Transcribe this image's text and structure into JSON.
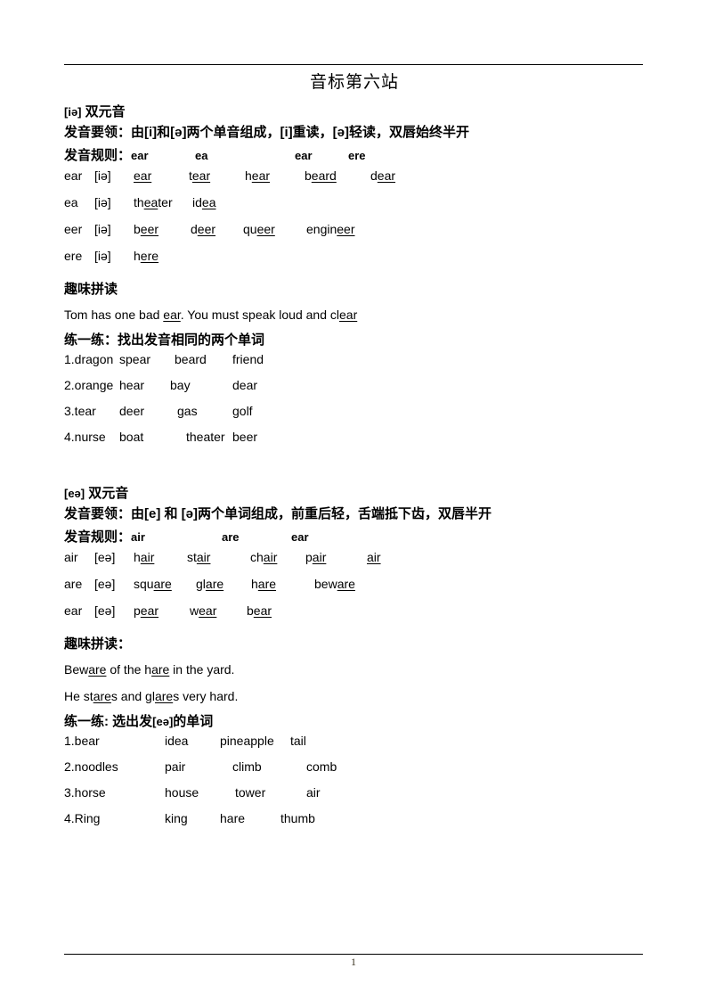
{
  "document": {
    "title": "音标第六站",
    "page_number": "1"
  },
  "sections": [
    {
      "id": "ia",
      "heading_ipa": "[iə]",
      "heading_text": " 双元音",
      "key_points_label": "发音要领：",
      "key_points_text": "由[i]和[ə]两个单音组成，[i]重读，[ə]轻读，双唇始终半开",
      "rules_label": "发音规则：",
      "rule_columns": [
        "ear",
        "ea",
        "ear",
        "ere"
      ],
      "word_rows": [
        {
          "key": "ear",
          "ipa": "[iə]",
          "words": [
            {
              "pre": "",
              "mid": "ear",
              "post": ""
            },
            {
              "pre": "t",
              "mid": "ear",
              "post": ""
            },
            {
              "pre": "h",
              "mid": "ear",
              "post": ""
            },
            {
              "pre": "b",
              "mid": "eard",
              "post": ""
            },
            {
              "pre": "d",
              "mid": "ear",
              "post": ""
            }
          ]
        },
        {
          "key": "ea",
          "ipa": "[iə]",
          "words": [
            {
              "pre": "th",
              "mid": "ea",
              "post": "ter"
            },
            {
              "pre": "id",
              "mid": "ea",
              "post": ""
            }
          ]
        },
        {
          "key": "eer",
          "ipa": "[iə]",
          "words": [
            {
              "pre": "b",
              "mid": "eer",
              "post": ""
            },
            {
              "pre": "d",
              "mid": "eer",
              "post": ""
            },
            {
              "pre": "qu",
              "mid": "eer",
              "post": ""
            },
            {
              "pre": "engin",
              "mid": "eer",
              "post": ""
            }
          ]
        },
        {
          "key": "ere",
          "ipa": "[iə]",
          "words": [
            {
              "pre": "h",
              "mid": "ere",
              "post": ""
            }
          ]
        }
      ],
      "fun_heading": "趣味拼读",
      "fun_lines": [
        [
          {
            "pre": "Tom has one bad ",
            "mid": "ear",
            "post": ". You must speak loud and cl"
          },
          {
            "pre": "",
            "mid": "ear",
            "post": ""
          }
        ]
      ],
      "practice_heading": "练一练：找出发音相同的两个单词",
      "practice_rows": [
        [
          "1.dragon",
          "spear",
          "beard",
          "friend"
        ],
        [
          "2.orange",
          "hear",
          "bay",
          "dear"
        ],
        [
          "3.tear",
          "deer",
          "gas",
          "golf"
        ],
        [
          "4.nurse",
          "boat",
          "theater",
          "beer"
        ]
      ]
    },
    {
      "id": "ea",
      "heading_ipa": "[eə]",
      "heading_text": " 双元音",
      "key_points_label": "发音要领：",
      "key_points_text": "由[e] 和 [ə]两个单词组成，前重后轻，舌端抵下齿，双唇半开",
      "rules_label": "发音规则：",
      "rule_columns": [
        "air",
        "are",
        "ear"
      ],
      "word_rows": [
        {
          "key": "air",
          "ipa": "[eə]",
          "words": [
            {
              "pre": "h",
              "mid": "air",
              "post": ""
            },
            {
              "pre": "st",
              "mid": "air",
              "post": ""
            },
            {
              "pre": "ch",
              "mid": "air",
              "post": ""
            },
            {
              "pre": "p",
              "mid": "air",
              "post": ""
            },
            {
              "pre": "",
              "mid": "air",
              "post": ""
            }
          ]
        },
        {
          "key": "are",
          "ipa": "[eə]",
          "words": [
            {
              "pre": "squ",
              "mid": "are",
              "post": ""
            },
            {
              "pre": "gl",
              "mid": "are",
              "post": ""
            },
            {
              "pre": "h",
              "mid": "are",
              "post": ""
            },
            {
              "pre": "bew",
              "mid": "are",
              "post": ""
            }
          ]
        },
        {
          "key": "ear",
          "ipa": "[eə]",
          "words": [
            {
              "pre": "p",
              "mid": "ear",
              "post": ""
            },
            {
              "pre": "w",
              "mid": "ear",
              "post": ""
            },
            {
              "pre": "b",
              "mid": "ear",
              "post": ""
            }
          ]
        }
      ],
      "fun_heading": "趣味拼读：",
      "fun_lines": [
        [
          {
            "pre": "Bew",
            "mid": "are",
            "post": " of the h"
          },
          {
            "pre": "",
            "mid": "are",
            "post": " in the yard."
          }
        ],
        [
          {
            "pre": "He st",
            "mid": "are",
            "post": "s and gl"
          },
          {
            "pre": "",
            "mid": "are",
            "post": "s very hard."
          }
        ]
      ],
      "practice_heading_pre": "练一练: 选出发",
      "practice_heading_ipa": "[eə]",
      "practice_heading_post": "的单词",
      "practice_rows": [
        [
          "1.bear",
          "idea",
          "pineapple",
          "tail"
        ],
        [
          "2.noodles",
          "pair",
          "climb",
          "comb"
        ],
        [
          "3.horse",
          "house",
          "tower",
          "air"
        ],
        [
          "4.Ring",
          "king",
          "hare",
          "thumb"
        ]
      ]
    }
  ]
}
